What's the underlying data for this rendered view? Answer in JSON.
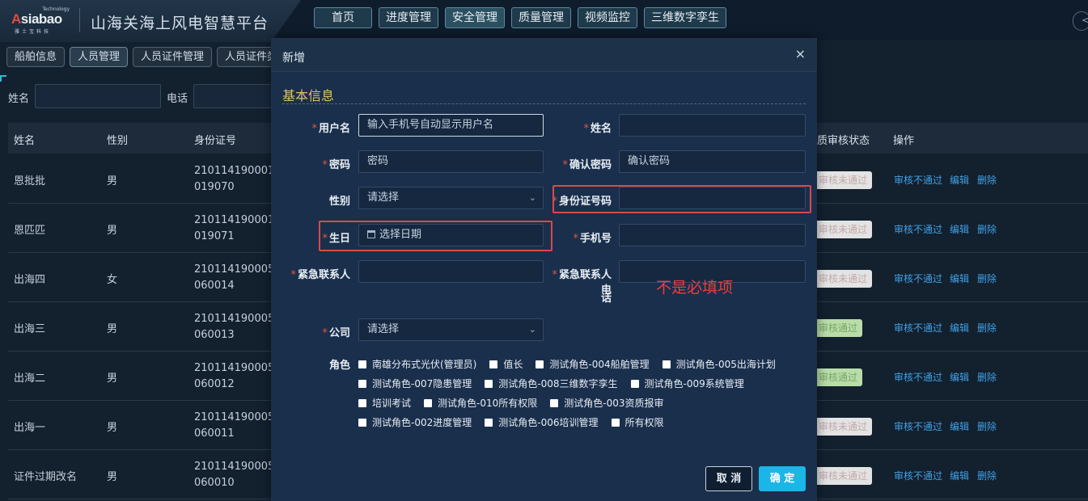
{
  "header": {
    "logo_top": "Technology",
    "logo_main_a": "A",
    "logo_main_rest": "siabao",
    "logo_sub": "雅士宝科技",
    "title": "山海关海上风电智慧平台",
    "nav": [
      "首页",
      "进度管理",
      "安全管理",
      "质量管理",
      "视频监控",
      "三维数字孪生"
    ],
    "right_glyph": "<"
  },
  "subnav": [
    "船舶信息",
    "人员管理",
    "人员证件管理",
    "人员证件类"
  ],
  "search": {
    "name_label": "姓名",
    "phone_label": "电话"
  },
  "table": {
    "headers": [
      "姓名",
      "性别",
      "身份证号",
      "质审核状态",
      "操作"
    ],
    "rows": [
      {
        "name": "恩批批",
        "gender": "男",
        "id": "210114190001019070",
        "status": "审核未通过"
      },
      {
        "name": "恩匹匹",
        "gender": "男",
        "id": "210114190001019071",
        "status": "审核未通过"
      },
      {
        "name": "出海四",
        "gender": "女",
        "id": "210114190005060014",
        "status": "审核未通过"
      },
      {
        "name": "出海三",
        "gender": "男",
        "id": "210114190005060013",
        "status": "审核通过"
      },
      {
        "name": "出海二",
        "gender": "男",
        "id": "210114190005060012",
        "status": "审核通过"
      },
      {
        "name": "出海一",
        "gender": "男",
        "id": "210114190005060011",
        "status": "审核未通过"
      },
      {
        "name": "证件过期改名",
        "gender": "男",
        "id": "210114190005060010",
        "status": "审核未通过"
      }
    ],
    "ops": [
      "审核不通过",
      "编辑",
      "删除"
    ]
  },
  "modal": {
    "title": "新增",
    "close": "×",
    "section": "基本信息",
    "req_mark": "*",
    "fields": {
      "username": {
        "label": "用户名",
        "value": "输入手机号自动显示用户名"
      },
      "name": {
        "label": "姓名",
        "value": ""
      },
      "password": {
        "label": "密码",
        "placeholder": "密码"
      },
      "confirm": {
        "label": "确认密码",
        "placeholder": "确认密码"
      },
      "gender": {
        "label": "性别",
        "placeholder": "请选择"
      },
      "idcard": {
        "label": "身份证号码",
        "value": ""
      },
      "birthday": {
        "label": "生日",
        "placeholder": "选择日期"
      },
      "phone": {
        "label": "手机号",
        "value": ""
      },
      "contact": {
        "label": "紧急联系人",
        "value": ""
      },
      "contact_phone": {
        "label1": "紧急联系人电",
        "label2": "话",
        "value": ""
      },
      "company": {
        "label": "公司",
        "placeholder": "请选择"
      },
      "role": {
        "label": "角色"
      }
    },
    "roles": [
      [
        "南雄分布式光伏(管理员)",
        "值长",
        "测试角色-004船舶管理",
        "测试角色-005出海计划"
      ],
      [
        "测试角色-007隐患管理",
        "测试角色-008三维数字孪生",
        "测试角色-009系统管理"
      ],
      [
        "培训考试",
        "测试角色-010所有权限",
        "测试角色-003资质报审"
      ],
      [
        "测试角色-002进度管理",
        "测试角色-006培训管理",
        "所有权限"
      ]
    ],
    "note": "不是必填项",
    "cancel": "取 消",
    "confirm_btn": "确 定"
  },
  "colors": {
    "accent": "#1bb6e8",
    "required": "#e4553f",
    "annotation": "#d94a48",
    "link": "#3fa1e6"
  }
}
